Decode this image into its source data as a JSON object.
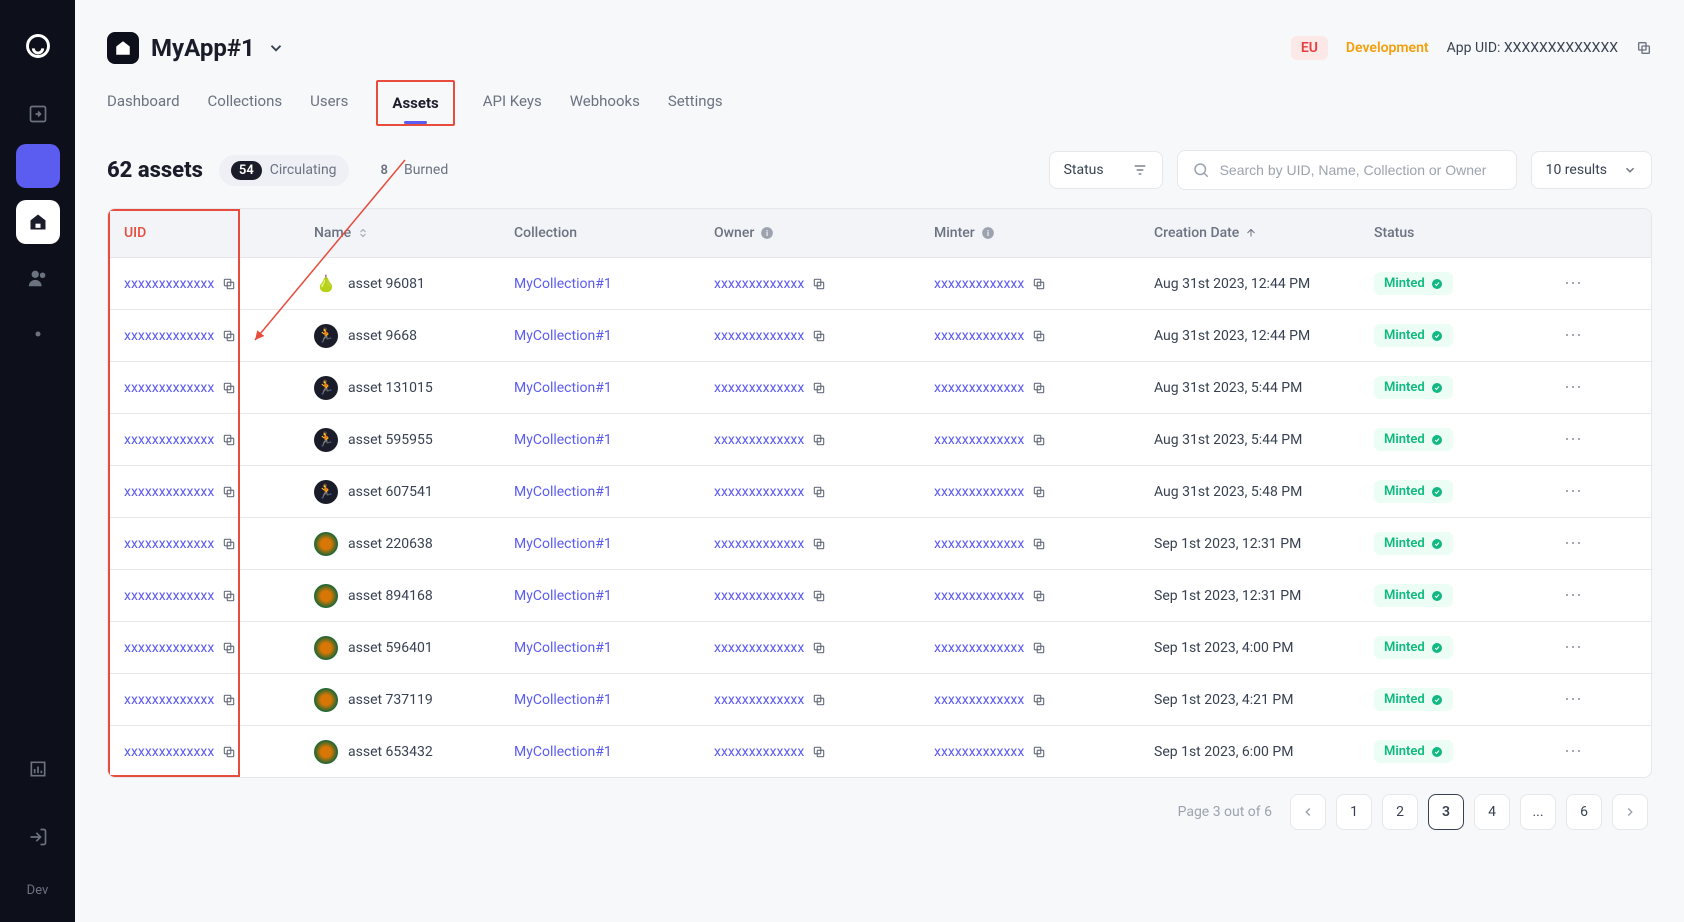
{
  "sidebar": {
    "dev_label": "Dev"
  },
  "header": {
    "app_name": "MyApp#1",
    "region": "EU",
    "environment": "Development",
    "app_uid_label": "App UID:",
    "app_uid_value": "XXXXXXXXXXXXX"
  },
  "tabs": [
    {
      "label": "Dashboard"
    },
    {
      "label": "Collections"
    },
    {
      "label": "Users"
    },
    {
      "label": "Assets"
    },
    {
      "label": "API Keys"
    },
    {
      "label": "Webhooks"
    },
    {
      "label": "Settings"
    }
  ],
  "title": "62 assets",
  "chips": {
    "circulating_count": "54",
    "circulating_label": "Circulating",
    "burned_count": "8",
    "burned_label": "Burned"
  },
  "controls": {
    "status_label": "Status",
    "search_placeholder": "Search by UID, Name, Collection or Owner",
    "results_label": "10 results"
  },
  "columns": {
    "uid": "UID",
    "name": "Name",
    "collection": "Collection",
    "owner": "Owner",
    "minter": "Minter",
    "creation": "Creation Date",
    "status": "Status"
  },
  "rows": [
    {
      "uid": "xxxxxxxxxxxxx",
      "name": "asset 96081",
      "collection": "MyCollection#1",
      "owner": "xxxxxxxxxxxxx",
      "minter": "xxxxxxxxxxxxx",
      "date": "Aug 31st 2023, 12:44 PM",
      "status": "Minted",
      "thumb": "pear"
    },
    {
      "uid": "xxxxxxxxxxxxx",
      "name": "asset 9668",
      "collection": "MyCollection#1",
      "owner": "xxxxxxxxxxxxx",
      "minter": "xxxxxxxxxxxxx",
      "date": "Aug 31st 2023, 12:44 PM",
      "status": "Minted",
      "thumb": "char"
    },
    {
      "uid": "xxxxxxxxxxxxx",
      "name": "asset 131015",
      "collection": "MyCollection#1",
      "owner": "xxxxxxxxxxxxx",
      "minter": "xxxxxxxxxxxxx",
      "date": "Aug 31st 2023, 5:44 PM",
      "status": "Minted",
      "thumb": "char"
    },
    {
      "uid": "xxxxxxxxxxxxx",
      "name": "asset 595955",
      "collection": "MyCollection#1",
      "owner": "xxxxxxxxxxxxx",
      "minter": "xxxxxxxxxxxxx",
      "date": "Aug 31st 2023, 5:44 PM",
      "status": "Minted",
      "thumb": "char"
    },
    {
      "uid": "xxxxxxxxxxxxx",
      "name": "asset 607541",
      "collection": "MyCollection#1",
      "owner": "xxxxxxxxxxxxx",
      "minter": "xxxxxxxxxxxxx",
      "date": "Aug 31st 2023, 5:48 PM",
      "status": "Minted",
      "thumb": "char"
    },
    {
      "uid": "xxxxxxxxxxxxx",
      "name": "asset 220638",
      "collection": "MyCollection#1",
      "owner": "xxxxxxxxxxxxx",
      "minter": "xxxxxxxxxxxxx",
      "date": "Sep 1st 2023, 12:31 PM",
      "status": "Minted",
      "thumb": "swirl"
    },
    {
      "uid": "xxxxxxxxxxxxx",
      "name": "asset 894168",
      "collection": "MyCollection#1",
      "owner": "xxxxxxxxxxxxx",
      "minter": "xxxxxxxxxxxxx",
      "date": "Sep 1st 2023, 12:31 PM",
      "status": "Minted",
      "thumb": "swirl"
    },
    {
      "uid": "xxxxxxxxxxxxx",
      "name": "asset 596401",
      "collection": "MyCollection#1",
      "owner": "xxxxxxxxxxxxx",
      "minter": "xxxxxxxxxxxxx",
      "date": "Sep 1st 2023, 4:00 PM",
      "status": "Minted",
      "thumb": "swirl"
    },
    {
      "uid": "xxxxxxxxxxxxx",
      "name": "asset 737119",
      "collection": "MyCollection#1",
      "owner": "xxxxxxxxxxxxx",
      "minter": "xxxxxxxxxxxxx",
      "date": "Sep 1st 2023, 4:21 PM",
      "status": "Minted",
      "thumb": "swirl"
    },
    {
      "uid": "xxxxxxxxxxxxx",
      "name": "asset 653432",
      "collection": "MyCollection#1",
      "owner": "xxxxxxxxxxxxx",
      "minter": "xxxxxxxxxxxxx",
      "date": "Sep 1st 2023, 6:00 PM",
      "status": "Minted",
      "thumb": "swirl"
    }
  ],
  "pagination": {
    "info": "Page 3 out of 6",
    "pages": [
      "1",
      "2",
      "3",
      "4",
      "...",
      "6"
    ],
    "current": "3"
  }
}
